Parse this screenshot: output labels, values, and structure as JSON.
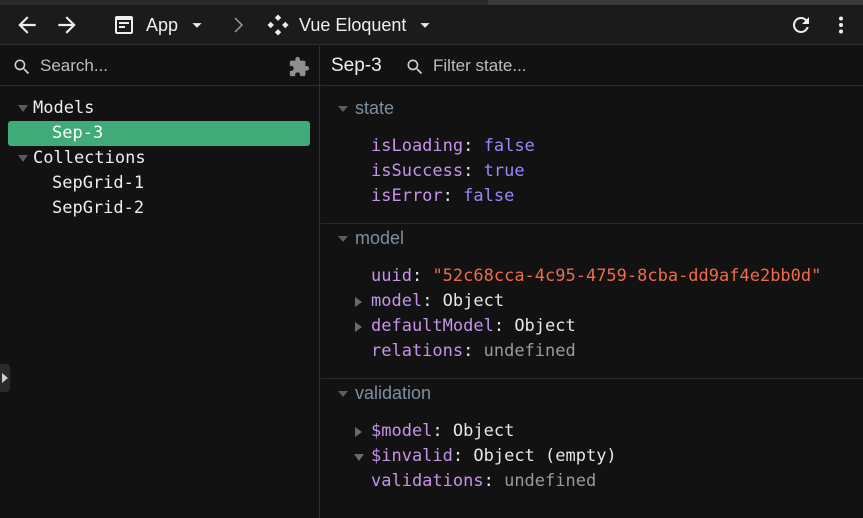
{
  "toolbar": {
    "app_label": "App",
    "plugin_label": "Vue Eloquent"
  },
  "sidebar": {
    "search_placeholder": "Search...",
    "tree": [
      {
        "label": "Models",
        "children": [
          "Sep-3"
        ]
      },
      {
        "label": "Collections",
        "children": [
          "SepGrid-1",
          "SepGrid-2"
        ]
      }
    ],
    "selected": "Sep-3"
  },
  "inspector": {
    "title": "Sep-3",
    "filter_placeholder": "Filter state...",
    "sections": [
      {
        "title": "state",
        "rows": [
          {
            "key": "isLoading",
            "value": "false",
            "kind": "bool",
            "expandable": false
          },
          {
            "key": "isSuccess",
            "value": "true",
            "kind": "bool",
            "expandable": false
          },
          {
            "key": "isError",
            "value": "false",
            "kind": "bool",
            "expandable": false
          }
        ]
      },
      {
        "title": "model",
        "rows": [
          {
            "key": "uuid",
            "value": "\"52c68cca-4c95-4759-8cba-dd9af4e2bb0d\"",
            "kind": "string",
            "expandable": false
          },
          {
            "key": "model",
            "value": "Object",
            "kind": "object",
            "expandable": true
          },
          {
            "key": "defaultModel",
            "value": "Object",
            "kind": "object",
            "expandable": true
          },
          {
            "key": "relations",
            "value": "undefined",
            "kind": "undefined",
            "expandable": false
          }
        ]
      },
      {
        "title": "validation",
        "rows": [
          {
            "key": "$model",
            "value": "Object",
            "kind": "object",
            "expandable": true
          },
          {
            "key": "$invalid",
            "value": "Object (empty)",
            "kind": "object",
            "expandable": true,
            "expanded": true
          },
          {
            "key": "validations",
            "value": "undefined",
            "kind": "undefined",
            "expandable": false
          }
        ]
      }
    ]
  },
  "colors": {
    "selected_bg": "#3eab78",
    "key": "#c792ea",
    "boolean": "#9b86ff",
    "string": "#ef6b4b",
    "section_title": "#7c8fa3"
  }
}
